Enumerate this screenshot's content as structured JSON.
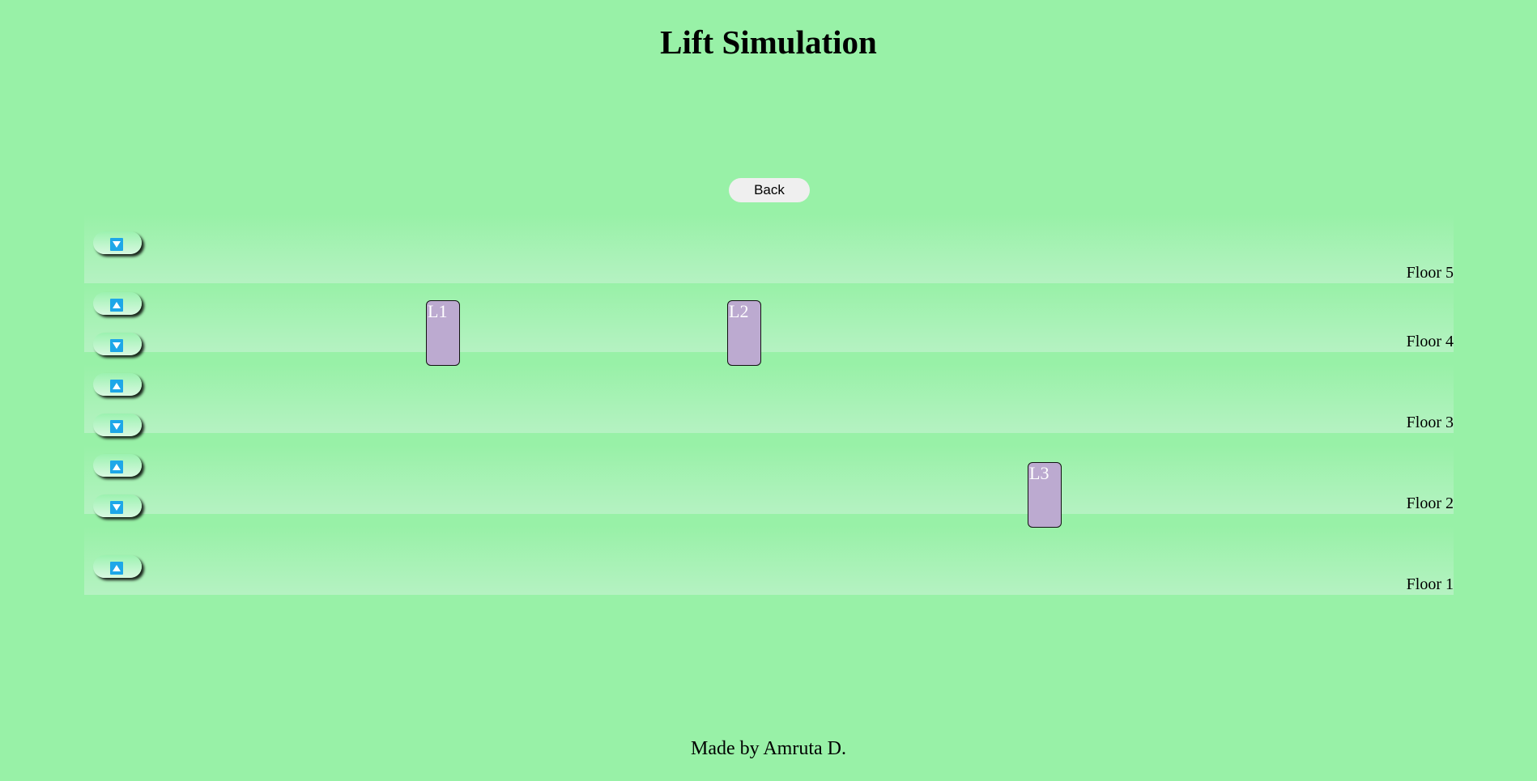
{
  "title": "Lift Simulation",
  "back_button": {
    "label": "Back"
  },
  "floors": [
    {
      "label": "Floor 5",
      "buttons": [
        "down"
      ]
    },
    {
      "label": "Floor 4",
      "buttons": [
        "up",
        "down"
      ]
    },
    {
      "label": "Floor 3",
      "buttons": [
        "up",
        "down"
      ]
    },
    {
      "label": "Floor 2",
      "buttons": [
        "up",
        "down"
      ]
    },
    {
      "label": "Floor 1",
      "buttons": [
        "up"
      ]
    }
  ],
  "lifts": [
    {
      "label": "L1",
      "floor": 4
    },
    {
      "label": "L2",
      "floor": 4
    },
    {
      "label": "L3",
      "floor": 2
    }
  ],
  "icons": {
    "up": "arrow-up-icon",
    "down": "arrow-down-icon"
  },
  "colors": {
    "background": "#98f1a7",
    "lift": "#bcaad0",
    "arrow_button": "#1ea7e8"
  },
  "footer": "Made by Amruta D."
}
